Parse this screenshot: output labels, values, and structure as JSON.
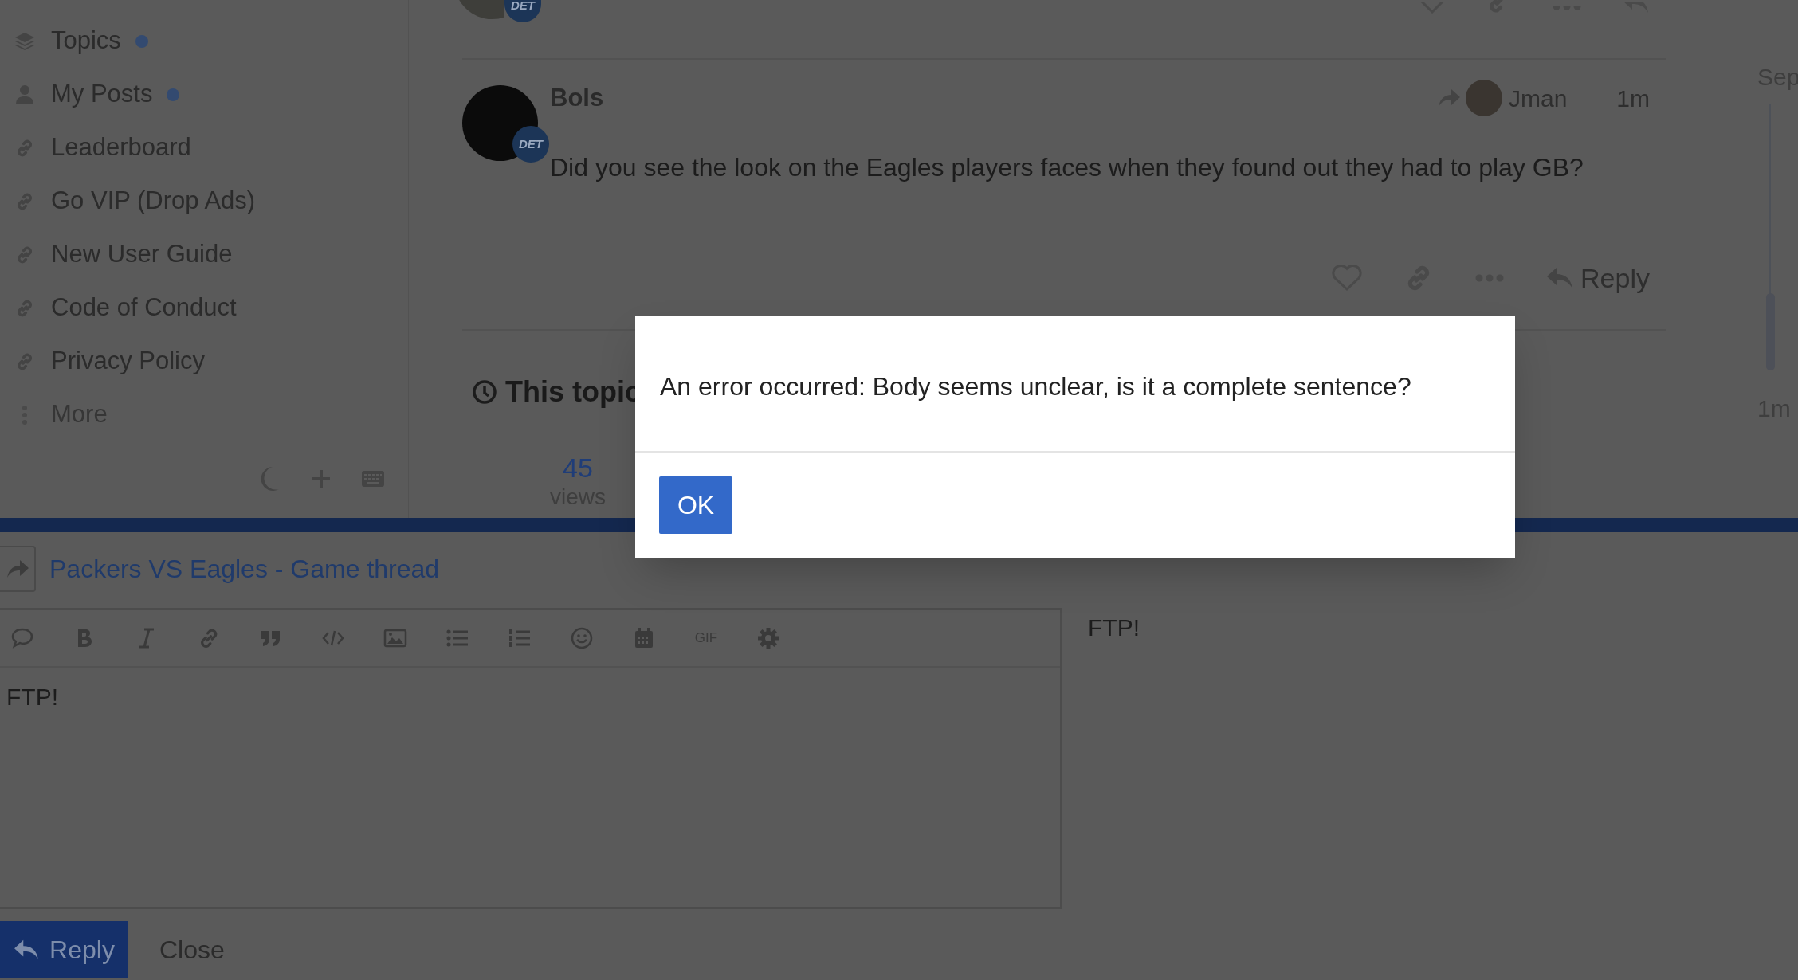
{
  "sidebar": {
    "items": [
      {
        "label": "Topics",
        "kind": "section",
        "unread": true
      },
      {
        "label": "My Posts",
        "kind": "profile",
        "unread": true
      },
      {
        "label": "Leaderboard",
        "kind": "link",
        "unread": false
      },
      {
        "label": "Go VIP (Drop Ads)",
        "kind": "link",
        "unread": false
      },
      {
        "label": "New User Guide",
        "kind": "link",
        "unread": false
      },
      {
        "label": "Code of Conduct",
        "kind": "link",
        "unread": false
      },
      {
        "label": "Privacy Policy",
        "kind": "link",
        "unread": false
      },
      {
        "label": "More",
        "kind": "more",
        "unread": false
      }
    ]
  },
  "previous_post": {
    "badge": "DET"
  },
  "post": {
    "author": "Bols",
    "badge": "DET",
    "reply_to": "Jman",
    "time": "1m",
    "body": "Did you see the look on the Eagles players faces when they found out they had to play GB?",
    "reply": "Reply"
  },
  "topic_map": {
    "title": "This topic",
    "stats": [
      {
        "value": "45",
        "label": "views"
      }
    ]
  },
  "timeline": {
    "start": "Sep",
    "end": "1m"
  },
  "composer": {
    "topic_title": "Packers VS Eagles - Game thread",
    "gif_label": "GIF",
    "text": "FTP!",
    "preview": "FTP!",
    "submit": "Reply",
    "cancel": "Close"
  },
  "dialog": {
    "message": "An error occurred: Body seems unclear, is it a complete sentence?",
    "button": "OK"
  }
}
